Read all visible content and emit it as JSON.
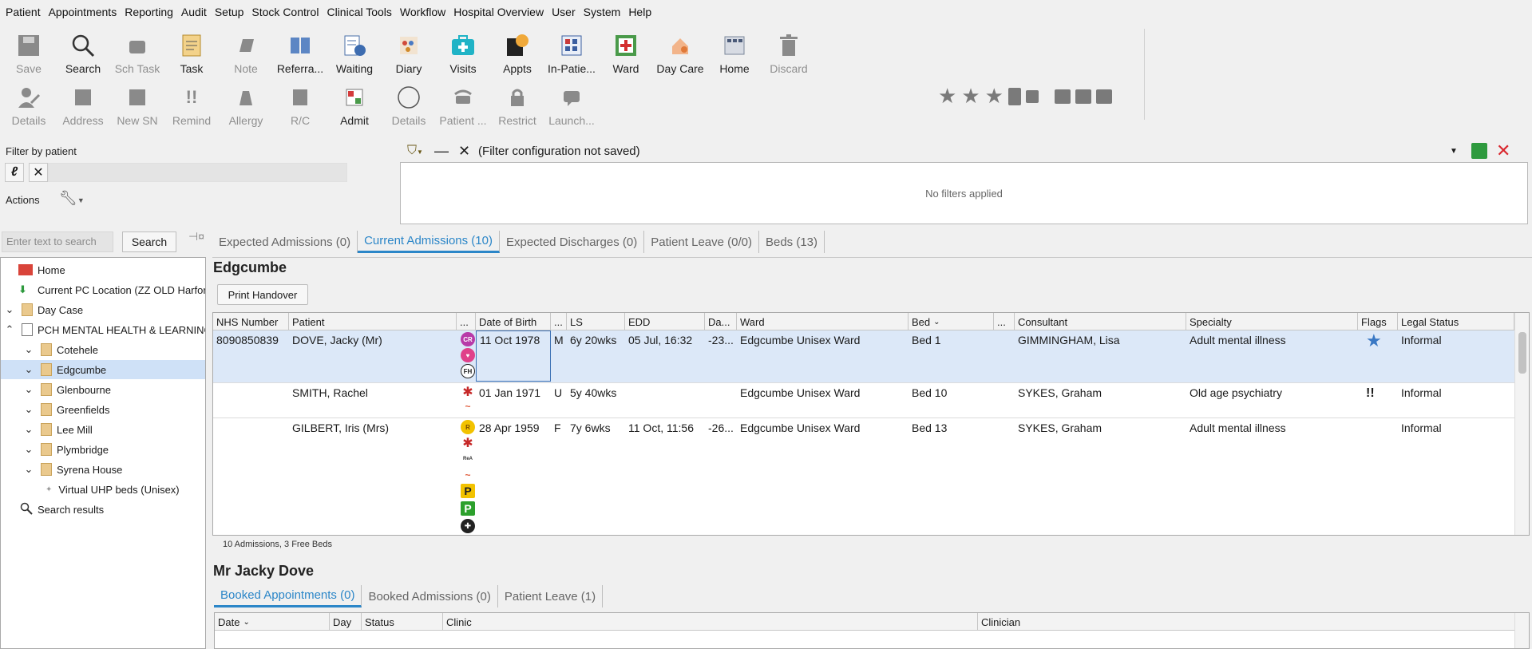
{
  "menu": [
    "Patient",
    "Appointments",
    "Reporting",
    "Audit",
    "Setup",
    "Stock Control",
    "Clinical Tools",
    "Workflow",
    "Hospital Overview",
    "User",
    "System",
    "Help"
  ],
  "toolbar_row1": [
    {
      "label": "Save",
      "icon": "save-icon",
      "enabled": false
    },
    {
      "label": "Search",
      "icon": "magnifier-icon",
      "enabled": true
    },
    {
      "label": "Sch Task",
      "icon": "scheduled-task-icon",
      "enabled": false
    },
    {
      "label": "Task",
      "icon": "task-icon",
      "enabled": true
    },
    {
      "label": "Note",
      "icon": "note-icon",
      "enabled": false
    },
    {
      "label": "Referra...",
      "icon": "referral-icon",
      "enabled": true
    },
    {
      "label": "Waiting",
      "icon": "waiting-list-icon",
      "enabled": true
    },
    {
      "label": "Diary",
      "icon": "diary-icon",
      "enabled": true
    },
    {
      "label": "Visits",
      "icon": "visits-icon",
      "enabled": true
    },
    {
      "label": "Appts",
      "icon": "appointments-icon",
      "enabled": true
    },
    {
      "label": "In-Patie...",
      "icon": "in-patient-icon",
      "enabled": true
    },
    {
      "label": "Ward",
      "icon": "ward-icon",
      "enabled": true
    },
    {
      "label": "Day Care",
      "icon": "day-care-icon",
      "enabled": true
    },
    {
      "label": "Home",
      "icon": "home-icon",
      "enabled": true
    },
    {
      "label": "Discard",
      "icon": "trash-icon",
      "enabled": false
    }
  ],
  "toolbar_row2": [
    {
      "label": "Details",
      "icon": "patient-details-icon",
      "enabled": false
    },
    {
      "label": "Address",
      "icon": "address-icon",
      "enabled": false
    },
    {
      "label": "New SN",
      "icon": "new-sn-icon",
      "enabled": false
    },
    {
      "label": "Remind",
      "icon": "reminder-icon",
      "enabled": false
    },
    {
      "label": "Allergy",
      "icon": "allergy-icon",
      "enabled": false
    },
    {
      "label": "R/C",
      "icon": "rc-icon",
      "enabled": false
    },
    {
      "label": "Admit",
      "icon": "admit-icon",
      "enabled": true
    },
    {
      "label": "Details",
      "icon": "circle-details-icon",
      "enabled": false
    },
    {
      "label": "Patient ...",
      "icon": "phone-icon",
      "enabled": false
    },
    {
      "label": "Restrict",
      "icon": "lock-icon",
      "enabled": false
    },
    {
      "label": "Launch...",
      "icon": "chat-icon",
      "enabled": false
    }
  ],
  "filter_by_patient": {
    "label": "Filter by patient",
    "actions_label": "Actions"
  },
  "filter": {
    "config_text": "(Filter configuration not saved)",
    "empty_text": "No filters applied"
  },
  "search": {
    "placeholder": "Enter text to search",
    "button": "Search"
  },
  "tree": [
    {
      "label": "Home",
      "icon": "home-icon",
      "chev": "",
      "indent": 0
    },
    {
      "label": "Current PC Location (ZZ OLD Harford)",
      "icon": "download-arrow-icon",
      "chev": "",
      "indent": 0
    },
    {
      "label": "Day Case",
      "icon": "folder-icon",
      "chev": "v",
      "indent": 0
    },
    {
      "label": "PCH MENTAL HEALTH & LEARNING",
      "icon": "building-icon",
      "chev": "^",
      "indent": 0
    },
    {
      "label": "Cotehele",
      "icon": "folder-icon",
      "chev": "v",
      "indent": 1
    },
    {
      "label": "Edgcumbe",
      "icon": "folder-icon",
      "chev": "v",
      "indent": 1,
      "selected": true
    },
    {
      "label": "Glenbourne",
      "icon": "folder-icon",
      "chev": "v",
      "indent": 1
    },
    {
      "label": "Greenfields",
      "icon": "folder-icon",
      "chev": "v",
      "indent": 1
    },
    {
      "label": "Lee Mill",
      "icon": "folder-icon",
      "chev": "v",
      "indent": 1
    },
    {
      "label": "Plymbridge",
      "icon": "folder-icon",
      "chev": "v",
      "indent": 1
    },
    {
      "label": "Syrena House",
      "icon": "folder-icon",
      "chev": "v",
      "indent": 1
    },
    {
      "label": "Virtual UHP beds (Unisex)",
      "icon": "dot-icon",
      "chev": "",
      "indent": 2
    },
    {
      "label": "Search results",
      "icon": "magnifier-icon",
      "chev": "",
      "indent": 0
    }
  ],
  "tabs": [
    {
      "label": "Expected Admissions (0)",
      "active": false
    },
    {
      "label": "Current Admissions (10)",
      "active": true
    },
    {
      "label": "Expected Discharges (0)",
      "active": false
    },
    {
      "label": "Patient Leave (0/0)",
      "active": false
    },
    {
      "label": "Beds (13)",
      "active": false
    }
  ],
  "ward_title": "Edgcumbe",
  "print_handover": "Print Handover",
  "grid": {
    "columns": [
      "NHS Number",
      "Patient",
      "...",
      "Date of Birth",
      "...",
      "LS",
      "EDD",
      "Da...",
      "Ward",
      "Bed",
      "...",
      "Consultant",
      "Specialty",
      "Flags",
      "Legal Status"
    ],
    "rows": [
      {
        "nhs": "8090850839",
        "patient": "DOVE, Jacky (Mr)",
        "dob": "11 Oct 1978",
        "sex": "M",
        "ls": "6y 20wks",
        "edd": "05 Jul, 16:32",
        "da": "-23...",
        "ward": "Edgcumbe Unisex Ward",
        "bed": "Bed 1",
        "consultant": "GIMMINGHAM, Lisa",
        "specialty": "Adult mental illness",
        "flags": "★",
        "legal": "Informal",
        "alerts": [
          "CR",
          "♥",
          "FH"
        ]
      },
      {
        "nhs": "",
        "patient": "SMITH, Rachel",
        "dob": "01 Jan 1971",
        "sex": "U",
        "ls": "5y 40wks",
        "edd": "",
        "da": "",
        "ward": "Edgcumbe Unisex Ward",
        "bed": "Bed 10",
        "consultant": "SYKES, Graham",
        "specialty": "Old age psychiatry",
        "flags": "!!",
        "legal": "Informal",
        "alerts": [
          "✱",
          "~"
        ]
      },
      {
        "nhs": "",
        "patient": "GILBERT, Iris (Mrs)",
        "dob": "28 Apr 1959",
        "sex": "F",
        "ls": "7y 6wks",
        "edd": "11 Oct, 11:56",
        "da": "-26...",
        "ward": "Edgcumbe Unisex Ward",
        "bed": "Bed 13",
        "consultant": "SYKES, Graham",
        "specialty": "Adult mental illness",
        "flags": "",
        "legal": "Informal",
        "alerts": [
          "R",
          "✱",
          "ReA",
          "~",
          "P",
          "P",
          "✚"
        ]
      }
    ]
  },
  "summary": "10 Admissions, 3 Free Beds",
  "patient_title": "Mr Jacky Dove",
  "subtabs": [
    {
      "label": "Booked Appointments (0)",
      "active": true
    },
    {
      "label": "Booked Admissions (0)",
      "active": false
    },
    {
      "label": "Patient Leave (1)",
      "active": false
    }
  ],
  "grid2_columns": [
    "Date",
    "Day",
    "Status",
    "Clinic",
    "Clinician"
  ],
  "colors": {
    "accent": "#2b86c8",
    "selection": "#dce8f8",
    "flag_star": "#3a78c4",
    "close_red": "#d9272e",
    "save_green": "#2e9a3e"
  }
}
